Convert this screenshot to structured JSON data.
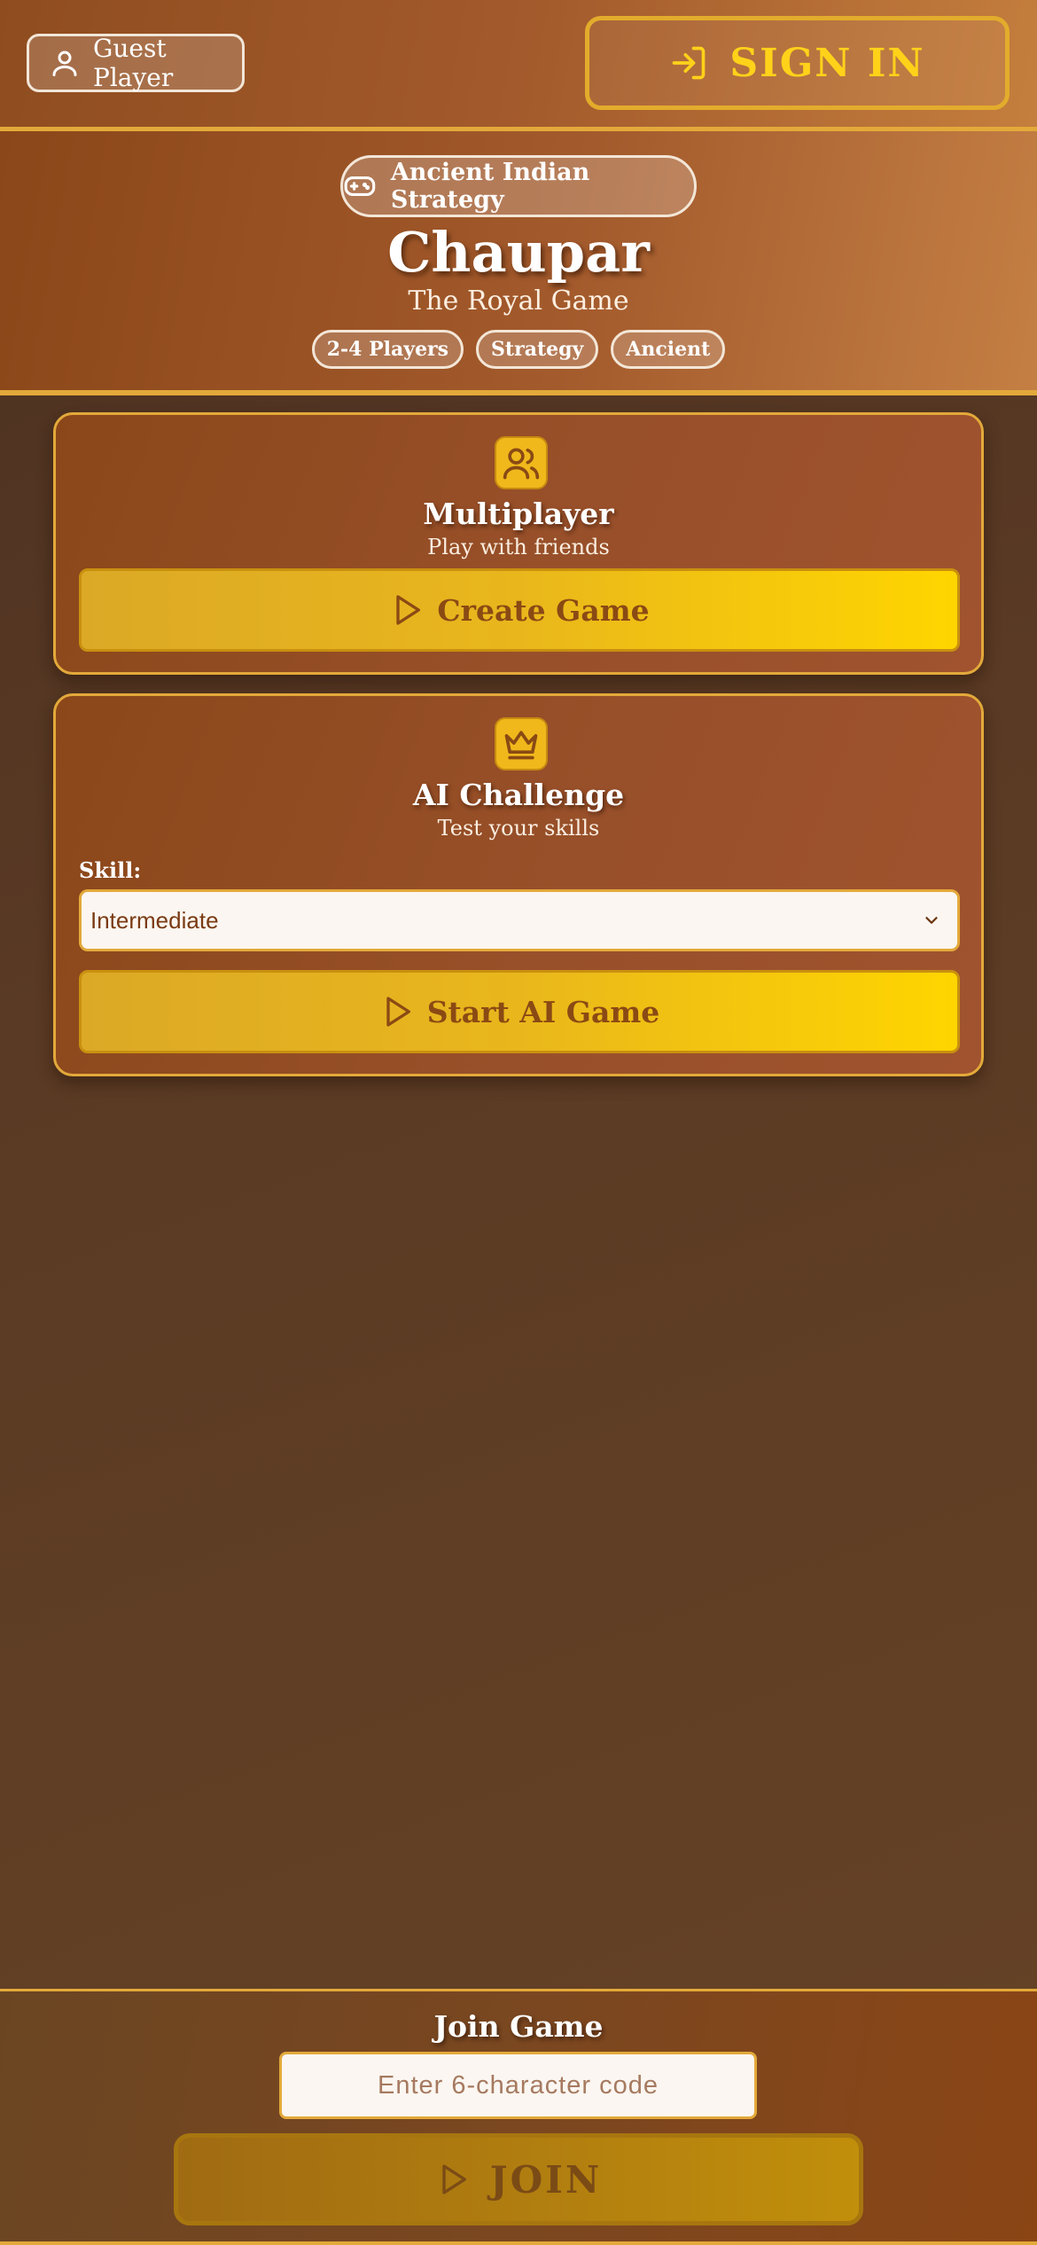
{
  "topbar": {
    "guest_label": "Guest Player",
    "guest_icon": "user-icon",
    "signin_label": "SIGN IN",
    "signin_icon": "log-in-icon"
  },
  "header": {
    "category": "Ancient Indian Strategy",
    "category_icon": "gamepad-icon",
    "title": "Chaupar",
    "subtitle": "The Royal Game",
    "tags": [
      "2-4 Players",
      "Strategy",
      "Ancient"
    ]
  },
  "multiplayer": {
    "icon": "users-icon",
    "title": "Multiplayer",
    "subtitle": "Play with friends",
    "button_label": "Create Game",
    "button_icon": "play-icon"
  },
  "ai": {
    "icon": "crown-icon",
    "title": "AI Challenge",
    "subtitle": "Test your skills",
    "skill_label": "Skill:",
    "skill_value": "Intermediate",
    "button_label": "Start AI Game",
    "button_icon": "play-icon"
  },
  "join": {
    "title": "Join Game",
    "code_placeholder": "Enter 6-character code",
    "button_label": "JOIN",
    "button_icon": "play-icon"
  },
  "colors": {
    "accent_gold": "#e3a93a",
    "button_yellow": "#ffd500",
    "brown_dark": "#4a3021",
    "brown_header": "#a35a2c",
    "signin_text": "#ffd21a"
  }
}
